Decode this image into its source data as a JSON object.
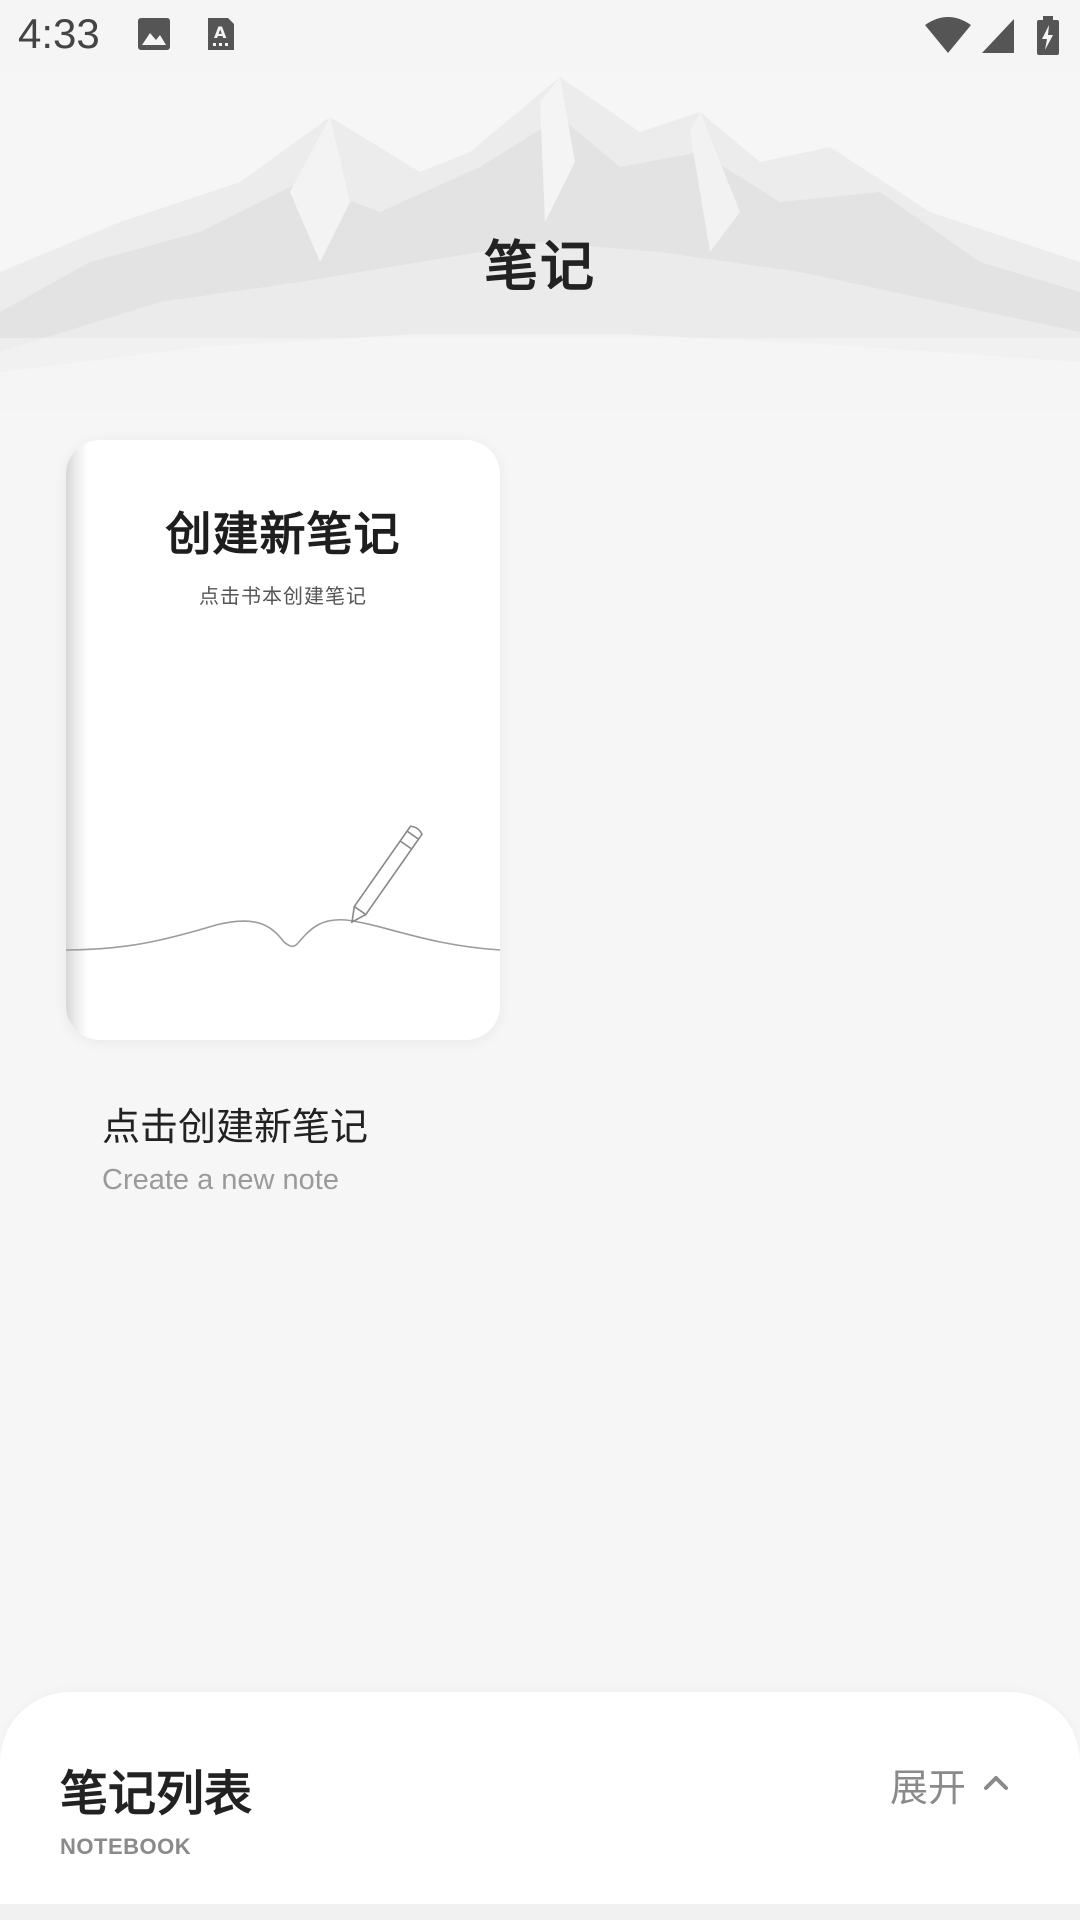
{
  "status_bar": {
    "time": "4:33",
    "left_icons": [
      "image-icon",
      "a-keyboard-icon"
    ],
    "right_icons": [
      "wifi-icon",
      "cell-signal-icon",
      "battery-charging-icon"
    ]
  },
  "header": {
    "title": "笔记"
  },
  "new_note_card": {
    "title": "创建新笔记",
    "subtitle": "点击书本创建笔记",
    "label": "点击创建新笔记",
    "sub_label": "Create a new note"
  },
  "bottom_sheet": {
    "title": "笔记列表",
    "subtitle": "NOTEBOOK",
    "expand_label": "展开",
    "expand_icon": "chevron-up-icon"
  }
}
